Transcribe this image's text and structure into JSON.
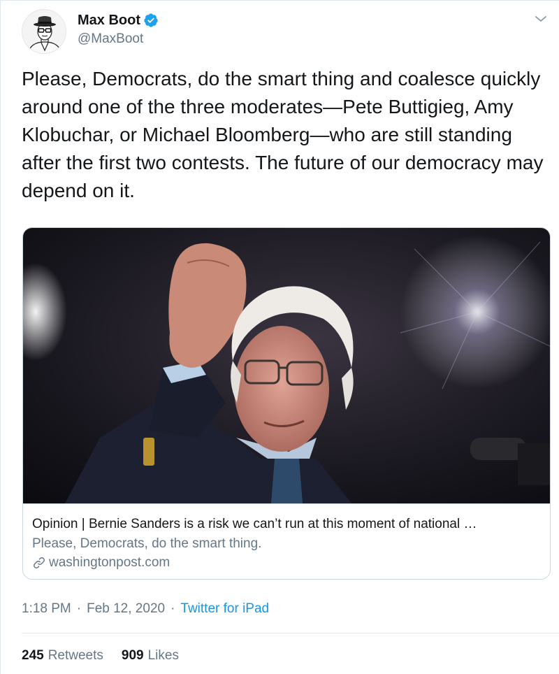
{
  "author": {
    "display_name": "Max Boot",
    "handle": "@MaxBoot",
    "verified": true,
    "verified_color": "#1da1f2",
    "avatar_icon": "man-in-hat-illustration"
  },
  "tweet": {
    "text": "Please, Democrats, do the smart thing and coalesce quickly around one of the three moderates—Pete Buttigieg, Amy Klobuchar, or Michael Bloomberg—who are still standing after the first two contests. The future of our democracy may depend on it."
  },
  "card": {
    "image_icon": "photo-of-man-raising-fist",
    "title": "Opinion | Bernie Sanders is a risk we can’t run at this moment of national …",
    "description": "Please, Democrats, do the smart thing.",
    "domain": "washingtonpost.com",
    "link_icon": "link-icon"
  },
  "meta": {
    "time": "1:18 PM",
    "separator": "·",
    "date": "Feb 12, 2020",
    "source": "Twitter for iPad",
    "source_color": "#1b95e0"
  },
  "stats": {
    "retweets_count": "245",
    "retweets_label": "Retweets",
    "likes_count": "909",
    "likes_label": "Likes"
  },
  "colors": {
    "text_primary": "#14171a",
    "text_secondary": "#657786",
    "border": "#ccd6dd"
  }
}
